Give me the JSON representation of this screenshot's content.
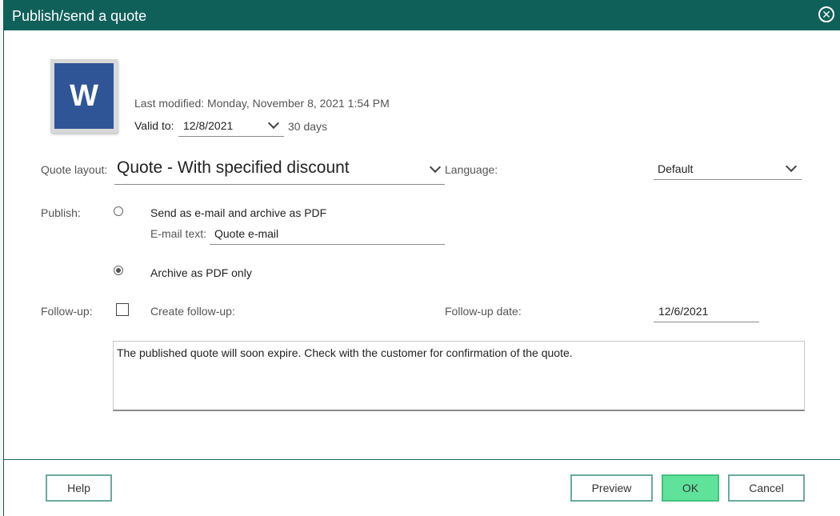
{
  "window": {
    "title": "Publish/send a quote"
  },
  "document": {
    "last_modified": "Last modified: Monday, November 8, 2021 1:54 PM",
    "valid_to_label": "Valid to:",
    "valid_to_value": "12/8/2021",
    "valid_days": "30 days"
  },
  "layout": {
    "label": "Quote layout:",
    "value": "Quote - With specified discount",
    "language_label": "Language:",
    "language_value": "Default"
  },
  "publish": {
    "label": "Publish:",
    "option_email": "Send as e-mail and archive as PDF",
    "email_text_label": "E-mail text:",
    "email_text_value": "Quote e-mail",
    "option_archive": "Archive as PDF only",
    "selected": "archive"
  },
  "followup": {
    "label": "Follow-up:",
    "create_label": "Create follow-up:",
    "date_label": "Follow-up date:",
    "date_value": "12/6/2021",
    "checked": false
  },
  "notes": "The published quote will soon expire. Check with the customer for confirmation of the quote.",
  "buttons": {
    "help": "Help",
    "preview": "Preview",
    "ok": "OK",
    "cancel": "Cancel"
  },
  "colors": {
    "titlebar": "#10605a",
    "ok_button": "#5fe39b",
    "word_icon": "#2f5597"
  },
  "icons": {
    "close": "close-circle-icon",
    "document": "word-document-icon"
  }
}
